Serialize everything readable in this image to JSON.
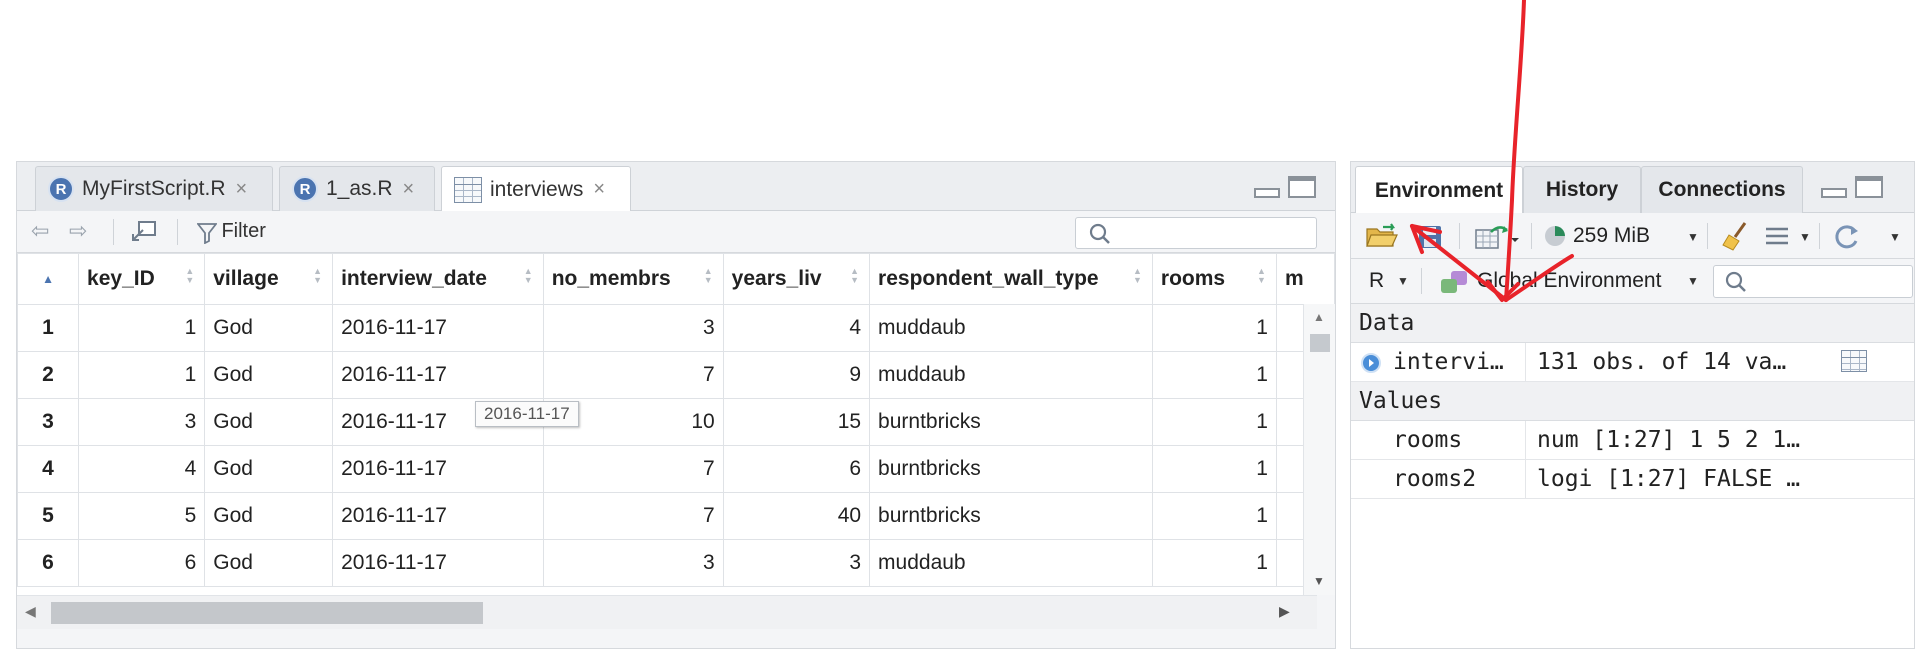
{
  "editor": {
    "tabs": [
      {
        "label": "MyFirstScript.R",
        "icon": "r-file-icon",
        "active": false
      },
      {
        "label": "1_as.R",
        "icon": "r-file-icon",
        "active": false
      },
      {
        "label": "interviews",
        "icon": "data-grid-icon",
        "active": true
      }
    ],
    "close_glyph": "×",
    "toolbar": {
      "filter_label": "Filter"
    },
    "tooltip": "2016-11-17"
  },
  "table": {
    "columns": [
      "key_ID",
      "village",
      "interview_date",
      "no_membrs",
      "years_liv",
      "respondent_wall_type",
      "rooms",
      "m"
    ],
    "rows": [
      {
        "n": "1",
        "key_ID": "1",
        "village": "God",
        "interview_date": "2016-11-17",
        "no_membrs": "3",
        "years_liv": "4",
        "wall": "muddaub",
        "rooms": "1"
      },
      {
        "n": "2",
        "key_ID": "1",
        "village": "God",
        "interview_date": "2016-11-17",
        "no_membrs": "7",
        "years_liv": "9",
        "wall": "muddaub",
        "rooms": "1"
      },
      {
        "n": "3",
        "key_ID": "3",
        "village": "God",
        "interview_date": "2016-11-17",
        "no_membrs": "10",
        "years_liv": "15",
        "wall": "burntbricks",
        "rooms": "1"
      },
      {
        "n": "4",
        "key_ID": "4",
        "village": "God",
        "interview_date": "2016-11-17",
        "no_membrs": "7",
        "years_liv": "6",
        "wall": "burntbricks",
        "rooms": "1"
      },
      {
        "n": "5",
        "key_ID": "5",
        "village": "God",
        "interview_date": "2016-11-17",
        "no_membrs": "7",
        "years_liv": "40",
        "wall": "burntbricks",
        "rooms": "1"
      },
      {
        "n": "6",
        "key_ID": "6",
        "village": "God",
        "interview_date": "2016-11-17",
        "no_membrs": "3",
        "years_liv": "3",
        "wall": "muddaub",
        "rooms": "1"
      }
    ]
  },
  "env": {
    "tabs": [
      "Environment",
      "History",
      "Connections"
    ],
    "memory": "259 MiB",
    "language": "R",
    "scope": "Global Environment",
    "data_header": "Data",
    "values_header": "Values",
    "data_items": [
      {
        "name": "intervi…",
        "value": "131 obs. of 14 va…"
      }
    ],
    "value_items": [
      {
        "name": "rooms",
        "value": "num [1:27] 1 5 2 1…"
      },
      {
        "name": "rooms2",
        "value": "logi [1:27] FALSE …"
      }
    ]
  },
  "colors": {
    "annotation": "#e8232a",
    "r_badge": "#4b74b0"
  }
}
